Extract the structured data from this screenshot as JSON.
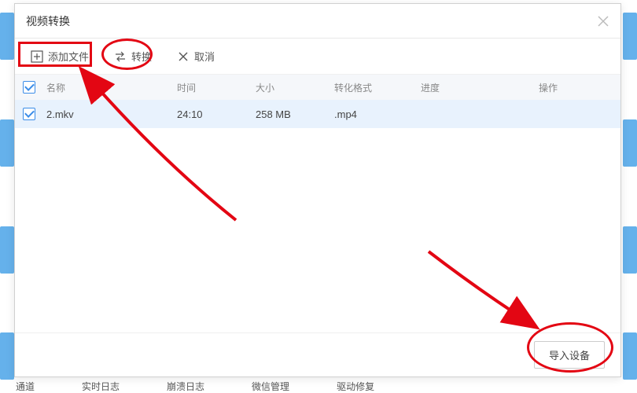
{
  "dialog": {
    "title": "视频转换"
  },
  "toolbar": {
    "add_label": "添加文件",
    "convert_label": "转换",
    "cancel_label": "取消"
  },
  "columns": {
    "name": "名称",
    "time": "时间",
    "size": "大小",
    "format": "转化格式",
    "progress": "进度",
    "action": "操作"
  },
  "rows": [
    {
      "checked": true,
      "name": "2.mkv",
      "time": "24:10",
      "size": "258 MB",
      "format": ".mp4",
      "progress": "",
      "action": ""
    }
  ],
  "footer": {
    "import_label": "导入设备"
  },
  "background": {
    "labels": [
      "通道",
      "实时日志",
      "崩溃日志",
      "微信管理",
      "驱动修复"
    ]
  }
}
